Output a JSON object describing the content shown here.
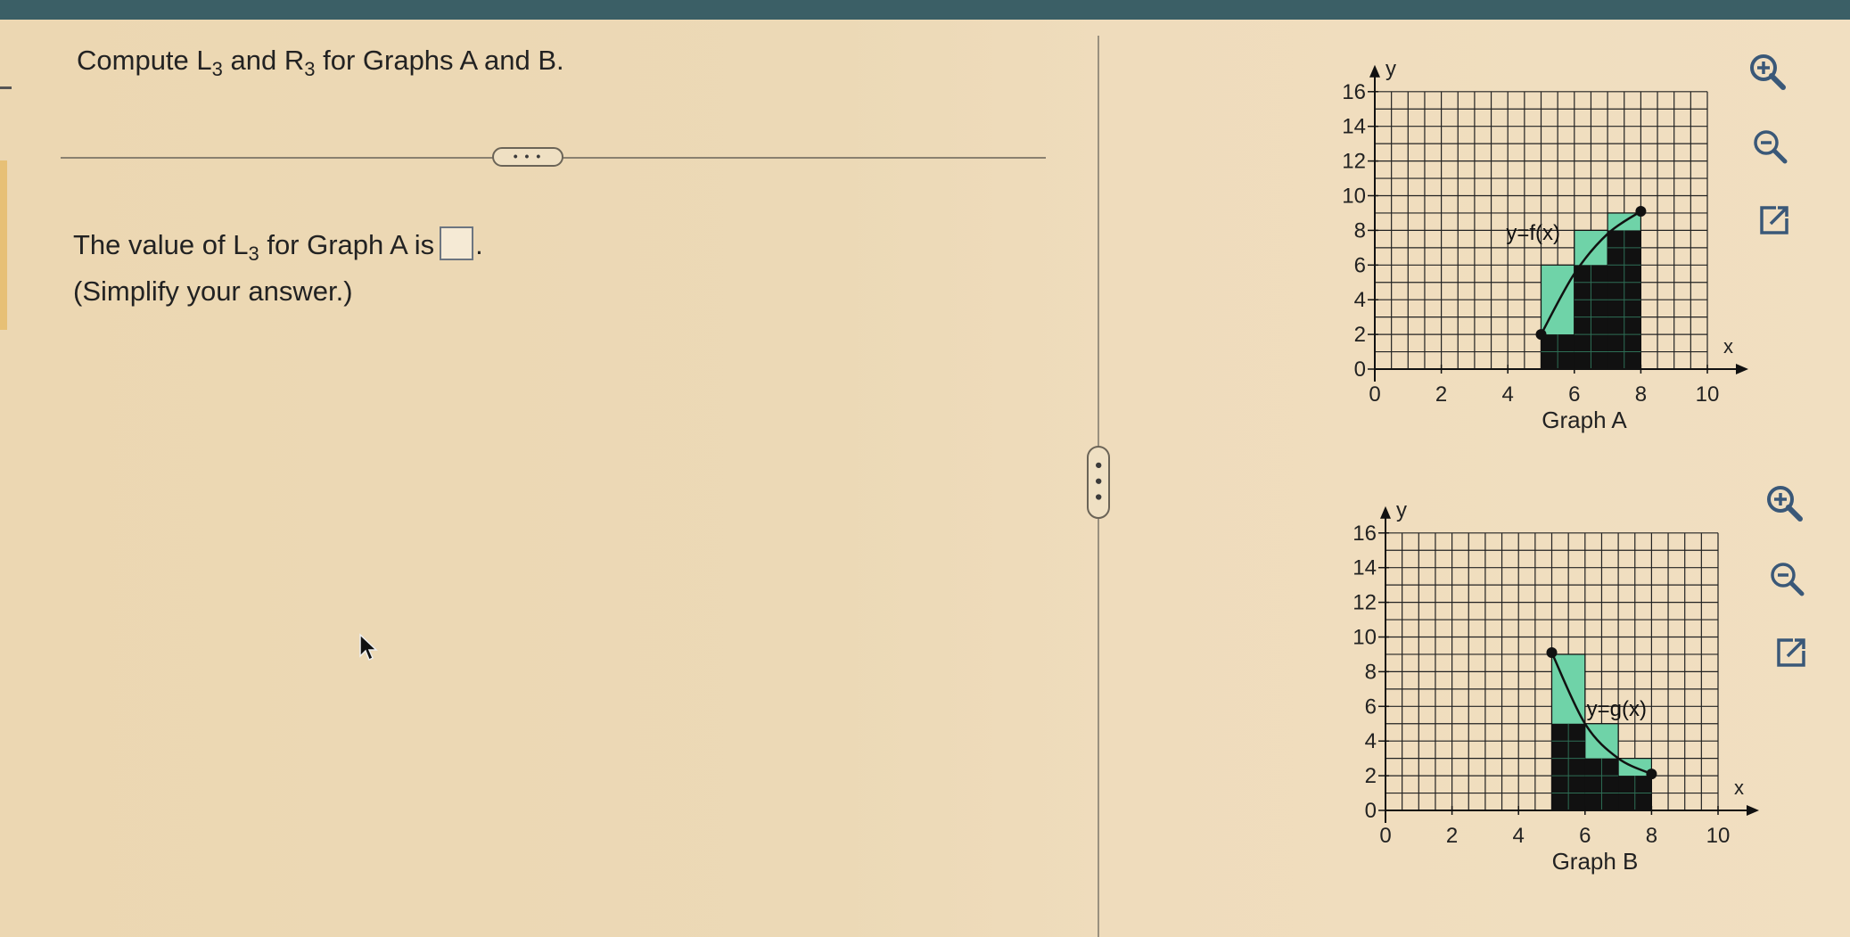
{
  "question": {
    "prefix": "Compute L",
    "l_sub": "3",
    "mid": " and R",
    "r_sub": "3",
    "suffix": " for Graphs A and B."
  },
  "expand_button": {
    "label": "• • •"
  },
  "answer": {
    "prefix": "The value of L",
    "sub": "3",
    "middle": " for Graph A is",
    "end": ".",
    "value": ""
  },
  "hint": "(Simplify your answer.)",
  "divider_handle": {
    "label": "• • •"
  },
  "graph_a": {
    "caption": "Graph A",
    "y_axis_label": "y",
    "x_axis_label": "x",
    "function_label": "y=f(x)",
    "x_ticks": [
      "0",
      "2",
      "4",
      "6",
      "8",
      "10"
    ],
    "y_ticks": [
      "0",
      "2",
      "4",
      "6",
      "8",
      "10",
      "12",
      "14",
      "16"
    ],
    "x_range": [
      0,
      10
    ],
    "y_range": [
      0,
      16
    ],
    "curve_points": [
      [
        5,
        2
      ],
      [
        6,
        5.5
      ],
      [
        7,
        7.8
      ],
      [
        8,
        9.1
      ]
    ],
    "left_rects": [
      {
        "x0": 5,
        "x1": 6,
        "h": 2
      },
      {
        "x0": 6,
        "x1": 7,
        "h": 6
      },
      {
        "x0": 7,
        "x1": 8,
        "h": 8
      }
    ],
    "right_rects": [
      {
        "x0": 5,
        "x1": 6,
        "h": 6
      },
      {
        "x0": 6,
        "x1": 7,
        "h": 8
      },
      {
        "x0": 7,
        "x1": 8,
        "h": 9
      }
    ],
    "endpoints": [
      [
        5,
        2
      ],
      [
        8,
        9.1
      ]
    ]
  },
  "graph_b": {
    "caption": "Graph B",
    "y_axis_label": "y",
    "x_axis_label": "x",
    "function_label": "y=g(x)",
    "x_ticks": [
      "0",
      "2",
      "4",
      "6",
      "8",
      "10"
    ],
    "y_ticks": [
      "0",
      "2",
      "4",
      "6",
      "8",
      "10",
      "12",
      "14",
      "16"
    ],
    "x_range": [
      0,
      10
    ],
    "y_range": [
      0,
      16
    ],
    "curve_points": [
      [
        5,
        9.1
      ],
      [
        6,
        5
      ],
      [
        7,
        3
      ],
      [
        8,
        2.1
      ]
    ],
    "left_rects": [
      {
        "x0": 5,
        "x1": 6,
        "h": 9
      },
      {
        "x0": 6,
        "x1": 7,
        "h": 5
      },
      {
        "x0": 7,
        "x1": 8,
        "h": 3
      }
    ],
    "right_rects": [
      {
        "x0": 5,
        "x1": 6,
        "h": 5
      },
      {
        "x0": 6,
        "x1": 7,
        "h": 3
      },
      {
        "x0": 7,
        "x1": 8,
        "h": 2
      }
    ],
    "endpoints": [
      [
        5,
        9.1
      ],
      [
        8,
        2.1
      ]
    ]
  },
  "colors": {
    "left_sum_fill": "#6fd3a8",
    "right_sum_fill": "#111111",
    "grid": "#222222",
    "curve": "#111111",
    "tool_icon": "#3a5878"
  },
  "tools_a": [
    "zoom-in-icon",
    "zoom-out-icon",
    "external-link-icon"
  ],
  "tools_b": [
    "zoom-in-icon",
    "zoom-out-icon",
    "external-link-icon"
  ]
}
